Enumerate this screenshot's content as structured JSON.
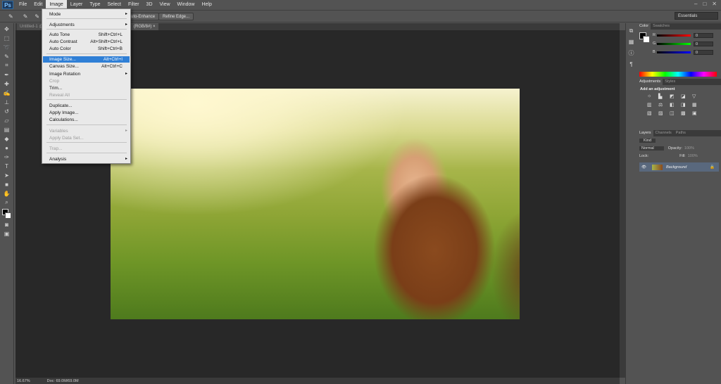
{
  "app": {
    "logo": "Ps"
  },
  "menubar": [
    "File",
    "Edit",
    "Image",
    "Layer",
    "Type",
    "Select",
    "Filter",
    "3D",
    "View",
    "Window",
    "Help"
  ],
  "window_controls": [
    "–",
    "□",
    "✕"
  ],
  "options_bar": {
    "auto_enhance": "Auto-Enhance",
    "refine_edge": "Refine Edge...",
    "workspace": "Essentials"
  },
  "doc_tabs": [
    "Untitled-1 @",
    "(RGB/8#)",
    "×"
  ],
  "status": {
    "zoom": "16.67%",
    "doc": "Doc: 69.0M/69.0M"
  },
  "image_menu": {
    "items": [
      {
        "label": "Mode",
        "shortcut": "",
        "submenu": true,
        "disabled": false
      },
      {
        "label": "Adjustments",
        "shortcut": "",
        "submenu": true,
        "disabled": false
      },
      {
        "label": "Auto Tone",
        "shortcut": "Shift+Ctrl+L",
        "submenu": false,
        "disabled": false
      },
      {
        "label": "Auto Contrast",
        "shortcut": "Alt+Shift+Ctrl+L",
        "submenu": false,
        "disabled": false
      },
      {
        "label": "Auto Color",
        "shortcut": "Shift+Ctrl+B",
        "submenu": false,
        "disabled": false
      },
      {
        "label": "Image Size...",
        "shortcut": "Alt+Ctrl+I",
        "submenu": false,
        "disabled": false,
        "highlighted": true
      },
      {
        "label": "Canvas Size...",
        "shortcut": "Alt+Ctrl+C",
        "submenu": false,
        "disabled": false
      },
      {
        "label": "Image Rotation",
        "shortcut": "",
        "submenu": true,
        "disabled": false
      },
      {
        "label": "Crop",
        "shortcut": "",
        "submenu": false,
        "disabled": true
      },
      {
        "label": "Trim...",
        "shortcut": "",
        "submenu": false,
        "disabled": false
      },
      {
        "label": "Reveal All",
        "shortcut": "",
        "submenu": false,
        "disabled": true
      },
      {
        "label": "Duplicate...",
        "shortcut": "",
        "submenu": false,
        "disabled": false
      },
      {
        "label": "Apply Image...",
        "shortcut": "",
        "submenu": false,
        "disabled": false
      },
      {
        "label": "Calculations...",
        "shortcut": "",
        "submenu": false,
        "disabled": false
      },
      {
        "label": "Variables",
        "shortcut": "",
        "submenu": true,
        "disabled": true
      },
      {
        "label": "Apply Data Set...",
        "shortcut": "",
        "submenu": false,
        "disabled": true
      },
      {
        "label": "Trap...",
        "shortcut": "",
        "submenu": false,
        "disabled": true
      },
      {
        "label": "Analysis",
        "shortcut": "",
        "submenu": true,
        "disabled": false
      }
    ]
  },
  "panels": {
    "color_tabs": [
      "Color",
      "Swatches"
    ],
    "color": {
      "R": "0",
      "G": "0",
      "B": "0"
    },
    "adjustments_tabs": [
      "Adjustments",
      "Styles"
    ],
    "adjustments_title": "Add an adjustment",
    "layers_tabs": [
      "Layers",
      "Channels",
      "Paths"
    ],
    "layers": {
      "kind": "Kind",
      "blend": "Normal",
      "opacity_label": "Opacity:",
      "opacity": "100%",
      "lock_label": "Lock:",
      "fill_label": "Fill:",
      "fill": "100%",
      "layer_name": "Background"
    }
  },
  "colors": {
    "menu_highlight": "#2f7fd6",
    "layer_selected": "#59687d"
  }
}
